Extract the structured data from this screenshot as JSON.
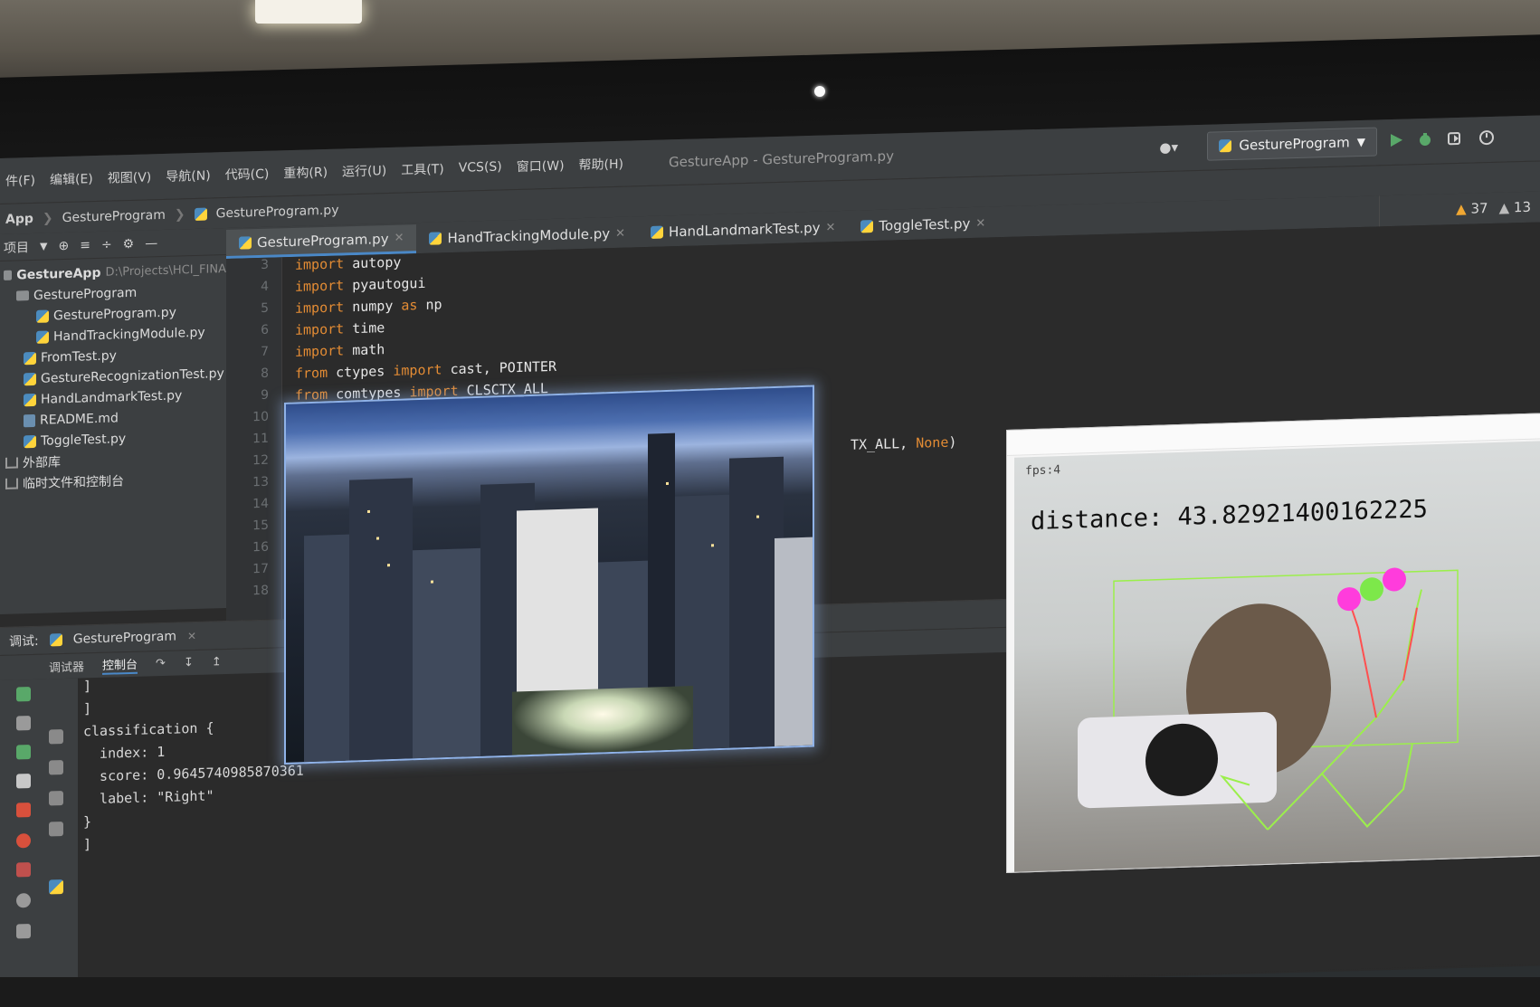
{
  "window": {
    "title": "GestureApp - GestureProgram.py"
  },
  "menu": [
    "件(F)",
    "编辑(E)",
    "视图(V)",
    "导航(N)",
    "代码(C)",
    "重构(R)",
    "运行(U)",
    "工具(T)",
    "VCS(S)",
    "窗口(W)",
    "帮助(H)"
  ],
  "toolbar": {
    "run_config": "GestureProgram"
  },
  "breadcrumb": [
    "App",
    "GestureProgram",
    "GestureProgram.py"
  ],
  "tabs": [
    {
      "label": "GestureProgram.py",
      "active": true
    },
    {
      "label": "HandTrackingModule.py",
      "active": false
    },
    {
      "label": "HandLandmarkTest.py",
      "active": false
    },
    {
      "label": "ToggleTest.py",
      "active": false
    }
  ],
  "inspections": {
    "warnings": "37",
    "weak_warnings": "13"
  },
  "project": {
    "toolbar_label": "项目",
    "root": "GestureApp",
    "root_path": "D:\\Projects\\HCI_FINA",
    "items": [
      {
        "label": "GestureProgram",
        "kind": "folder"
      },
      {
        "label": "GestureProgram.py",
        "kind": "py"
      },
      {
        "label": "HandTrackingModule.py",
        "kind": "py"
      },
      {
        "label": "FromTest.py",
        "kind": "py"
      },
      {
        "label": "GestureRecognizationTest.py",
        "kind": "py"
      },
      {
        "label": "HandLandmarkTest.py",
        "kind": "py"
      },
      {
        "label": "README.md",
        "kind": "md"
      },
      {
        "label": "ToggleTest.py",
        "kind": "py"
      },
      {
        "label": "外部库",
        "kind": "lib"
      },
      {
        "label": "临时文件和控制台",
        "kind": "lib"
      }
    ]
  },
  "editor": {
    "line_numbers": [
      "3",
      "4",
      "5",
      "6",
      "7",
      "8",
      "9",
      "10",
      "11",
      "12",
      "13",
      "14",
      "15",
      "16",
      "17",
      "18"
    ],
    "lines": [
      {
        "kw": "import",
        "rest": " autopy"
      },
      {
        "kw": "import",
        "rest": " pyautogui"
      },
      {
        "kw": "import",
        "rest": " numpy ",
        "kw2": "as",
        "rest2": " np"
      },
      {
        "kw": "import",
        "rest": " time"
      },
      {
        "kw": "import",
        "rest": " math"
      },
      {
        "kw": "from",
        "rest": " ctypes ",
        "kw2": "import",
        "rest2": " cast, POINTER"
      },
      {
        "kw": "from",
        "rest": " comtypes ",
        "kw2": "import",
        "rest2": " CLSCTX_ALL"
      }
    ],
    "partial_line": {
      "text": "TX_ALL, ",
      "kw": "None",
      "tail": ")"
    }
  },
  "run": {
    "label": "调试:",
    "config": "GestureProgram",
    "subtabs": [
      "调试器",
      "控制台"
    ],
    "console": [
      "]",
      "]",
      "classification {",
      "  index: 1",
      "  score: 0.9645740985870361",
      "  label: \"Right\"",
      "}",
      "]"
    ]
  },
  "camera": {
    "fps": "fps:4",
    "distance": "distance: 43.82921400162225"
  },
  "colors": {
    "keyword": "#e48c34",
    "accent": "#4a88c7",
    "warning": "#f0a732",
    "landmark_line": "#9bef4b",
    "fingertip_magenta": "#ff3cdc",
    "fingertip_green": "#7de84a"
  }
}
